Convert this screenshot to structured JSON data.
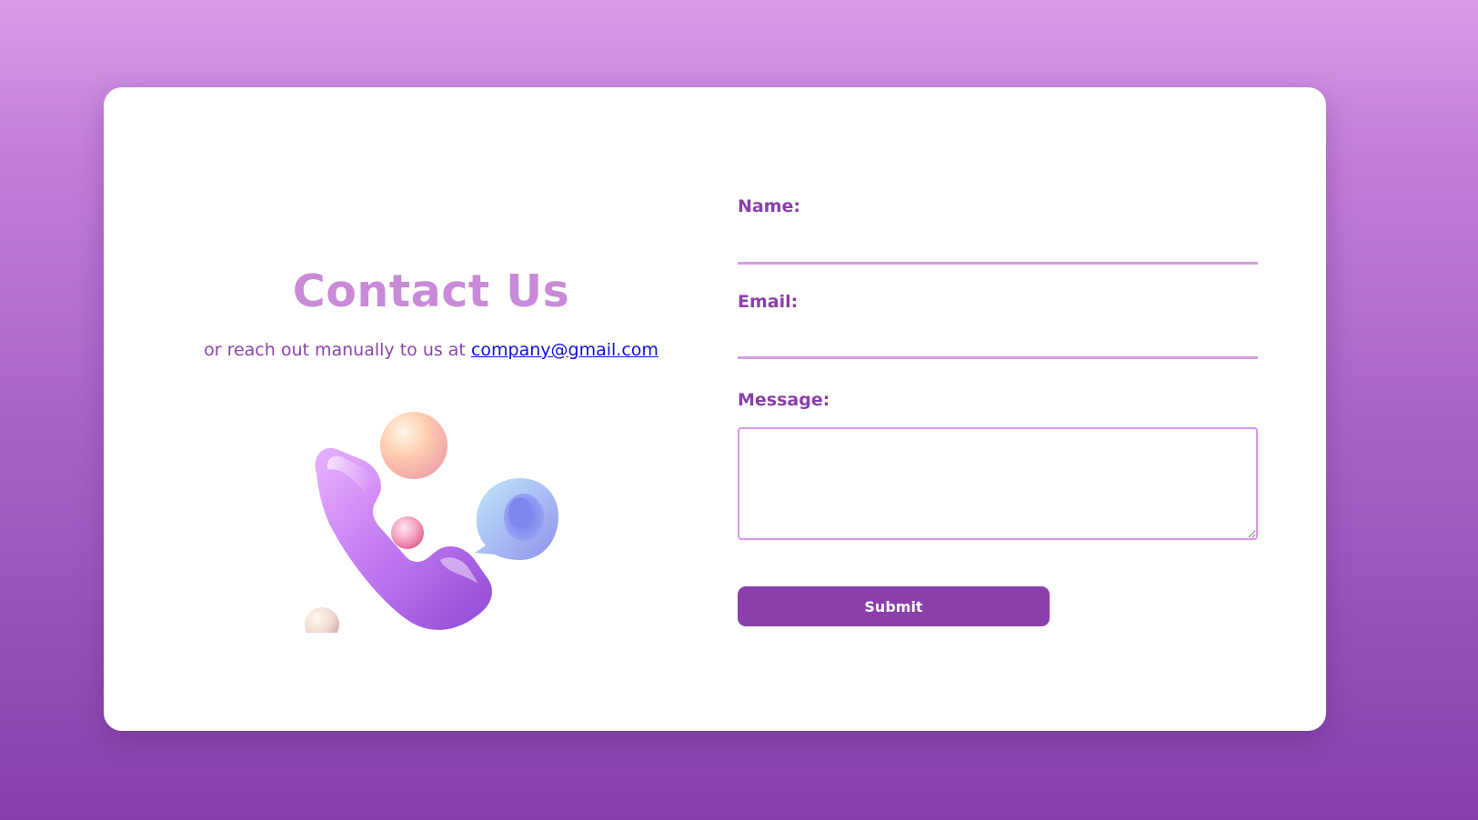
{
  "contact": {
    "title": "Contact Us",
    "subtitle_prefix": "or reach out manually to us at",
    "email_link": "company@gmail.com",
    "illustration_icon": "phone-call-3d-icon"
  },
  "form": {
    "name_label": "Name:",
    "name_value": "",
    "email_label": "Email:",
    "email_value": "",
    "message_label": "Message:",
    "message_value": "",
    "submit_label": "Submit"
  },
  "colors": {
    "background_top": "#d89be6",
    "background_bottom": "#8640ac",
    "title": "#c98ad8",
    "labels": "#8a3fa8",
    "input_underline": "#d99be6",
    "button": "#8a3fab",
    "link": "#1010d8"
  }
}
